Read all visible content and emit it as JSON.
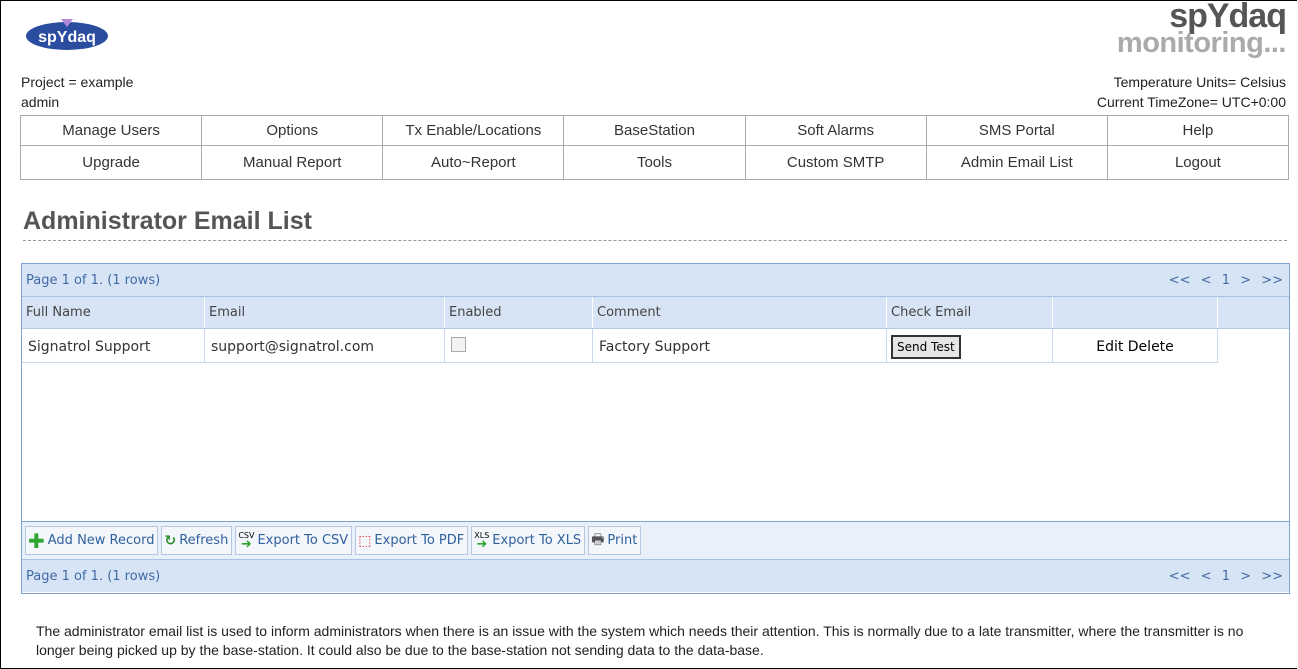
{
  "brand": {
    "logo_text": "spYdaq",
    "line1": "spYdaq",
    "line2": "monitoring..."
  },
  "header": {
    "project": "Project = example",
    "user": "admin",
    "temp_units": "Temperature Units= Celsius",
    "timezone": "Current TimeZone= UTC+0:00"
  },
  "nav": {
    "row1": [
      "Manage Users",
      "Options",
      "Tx Enable/Locations",
      "BaseStation",
      "Soft Alarms",
      "SMS Portal",
      "Help"
    ],
    "row2": [
      "Upgrade",
      "Manual Report",
      "Auto~Report",
      "Tools",
      "Custom SMTP",
      "Admin Email List",
      "Logout"
    ]
  },
  "page_title": "Administrator Email List",
  "grid": {
    "pager_text": "Page 1 of 1. (1 rows)",
    "pager_links": {
      "first": "<<",
      "prev": "<",
      "page": "1",
      "next": ">",
      "last": ">>"
    },
    "columns": [
      "Full Name",
      "Email",
      "Enabled",
      "Comment",
      "Check Email",
      ""
    ],
    "rows": [
      {
        "full_name": "Signatrol Support",
        "email": "support@signatrol.com",
        "enabled": false,
        "comment": "Factory Support",
        "check_email": "Send Test",
        "actions": "Edit Delete"
      }
    ],
    "toolbar": {
      "add": "Add New Record",
      "refresh": "Refresh",
      "csv": "Export To CSV",
      "csv_badge": "CSV",
      "pdf": "Export To PDF",
      "xls": "Export To XLS",
      "xls_badge": "XLS",
      "print": "Print"
    }
  },
  "footer_text": "The administrator email list is used to inform administrators when there is an issue with the system which needs their attention. This is normally due to a late transmitter, where the transmitter is no longer being picked up by the base-station. It could also be due to the base-station not sending data to the data-base."
}
